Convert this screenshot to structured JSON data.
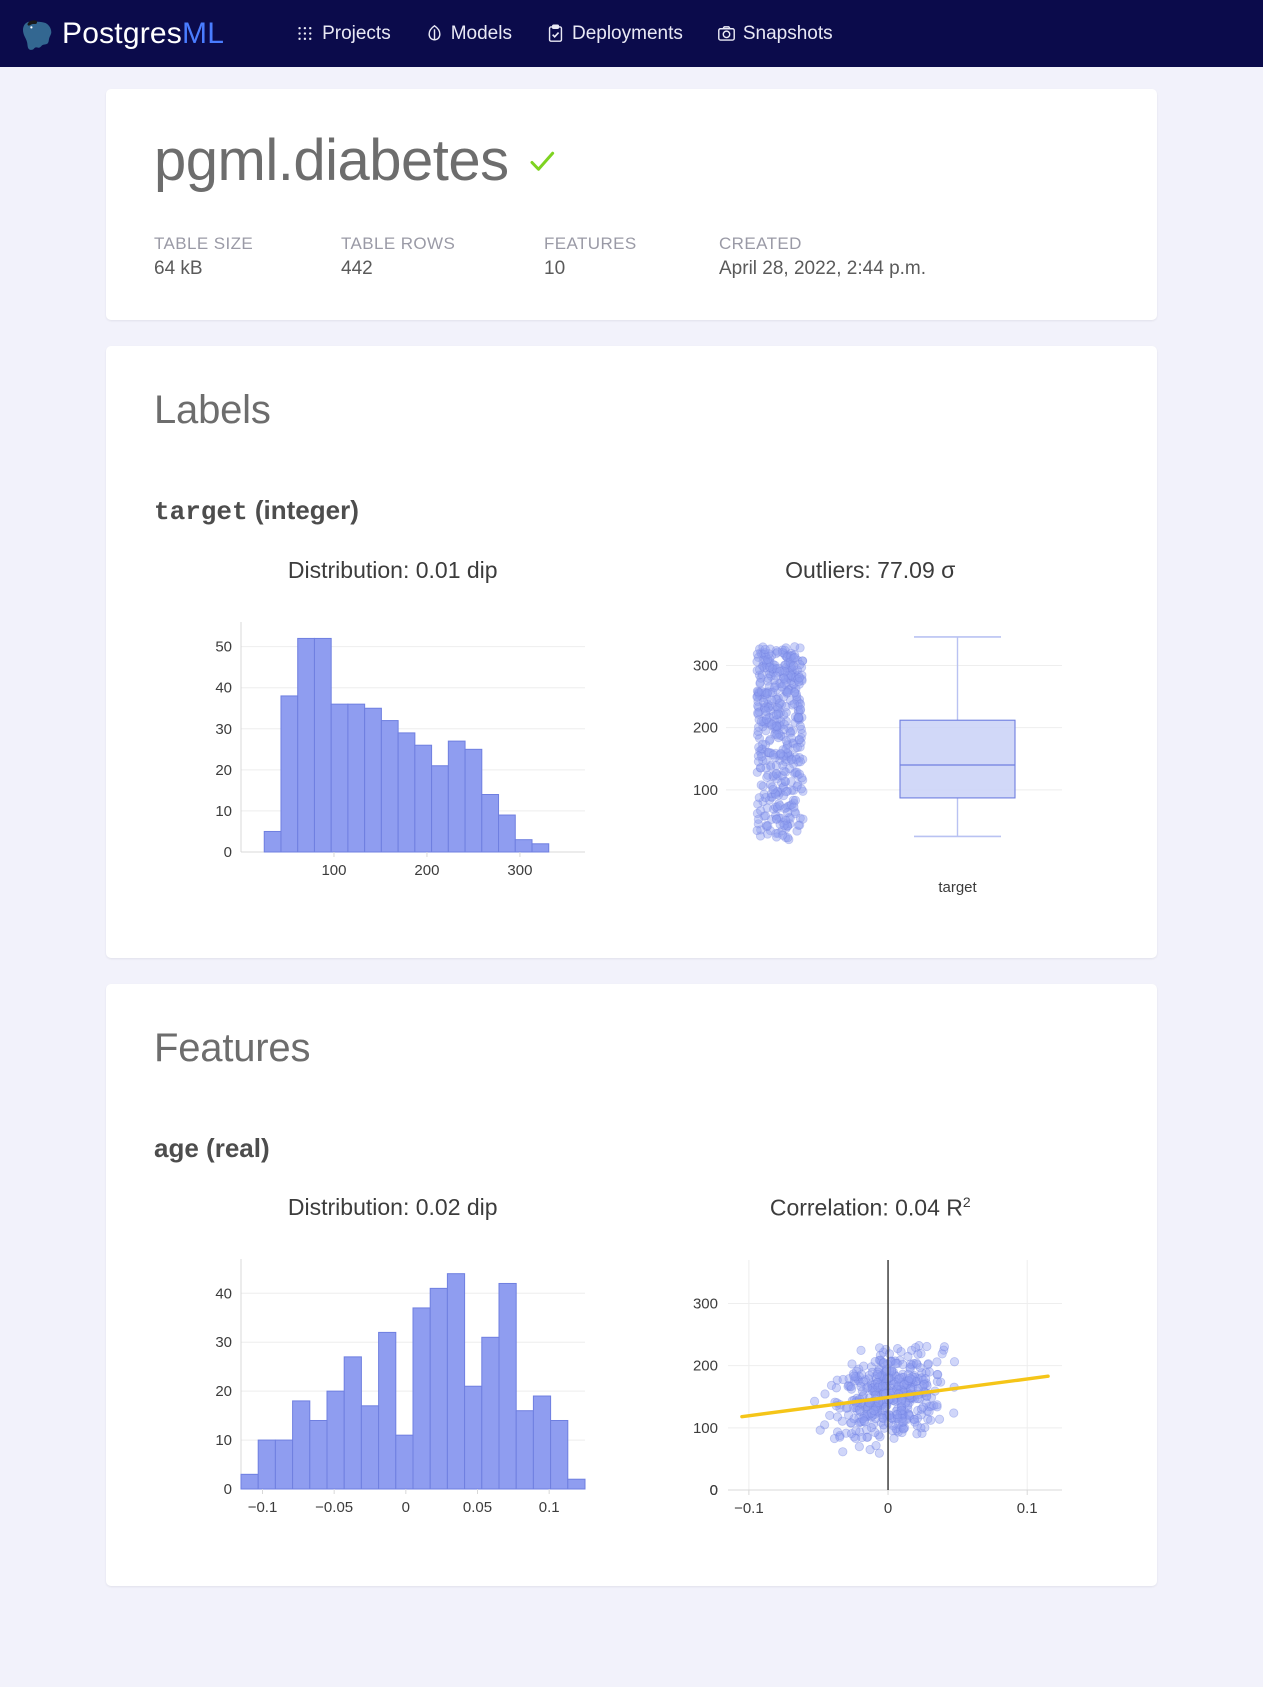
{
  "navbar": {
    "brand_primary": "Postgres",
    "brand_accent": "ML",
    "links": [
      {
        "label": "Projects",
        "icon": "grid-icon"
      },
      {
        "label": "Models",
        "icon": "model-icon"
      },
      {
        "label": "Deployments",
        "icon": "clipboard-check-icon"
      },
      {
        "label": "Snapshots",
        "icon": "camera-icon"
      }
    ]
  },
  "header": {
    "title": "pgml.diabetes",
    "status_icon": "check-icon",
    "stats": [
      {
        "label": "TABLE SIZE",
        "value": "64 kB"
      },
      {
        "label": "TABLE ROWS",
        "value": "442"
      },
      {
        "label": "FEATURES",
        "value": "10"
      },
      {
        "label": "CREATED",
        "value": "April 28, 2022, 2:44 p.m."
      }
    ]
  },
  "labels_section": {
    "heading": "Labels",
    "column_name": "target",
    "column_type": "(integer)",
    "distribution_title": "Distribution: 0.01 dip",
    "outliers_title": "Outliers: 77.09 σ"
  },
  "features_section": {
    "heading": "Features",
    "column_name": "age",
    "column_type": "(real)",
    "distribution_title": "Distribution: 0.02 dip",
    "correlation_title_prefix": "Correlation: 0.04 R",
    "correlation_title_sup": "2"
  },
  "colors": {
    "navbar_bg": "#0b0b4b",
    "brand_accent": "#4a7dff",
    "page_bg": "#f2f2fb",
    "card_bg": "#ffffff",
    "bar_fill": "#8f9df0",
    "bar_stroke": "#6f7fe0",
    "point_fill": "#8f9df0",
    "trend_line": "#f5c518",
    "check_green": "#7ed321",
    "axis_text": "#3c3c3c",
    "grid": "#eeeeee"
  },
  "chart_data": [
    {
      "type": "bar",
      "name": "target-distribution-histogram",
      "title": "Distribution: 0.01 dip",
      "xlabel": "",
      "ylabel": "",
      "xlim": [
        0,
        370
      ],
      "ylim": [
        0,
        56
      ],
      "yticks": [
        0,
        10,
        20,
        30,
        40,
        50
      ],
      "xticks": [
        100,
        200,
        300
      ],
      "bin_edges": [
        25,
        43,
        61,
        79,
        97,
        115,
        133,
        151,
        169,
        187,
        205,
        223,
        241,
        259,
        277,
        295,
        313,
        331,
        349
      ],
      "values": [
        5,
        38,
        52,
        52,
        36,
        36,
        35,
        32,
        29,
        26,
        21,
        27,
        25,
        14,
        9,
        3,
        2
      ],
      "grid": true
    },
    {
      "type": "box",
      "name": "target-outliers-boxplot",
      "title": "Outliers: 77.09 σ",
      "category_label": "target",
      "ylim": [
        0,
        370
      ],
      "yticks": [
        100,
        200,
        300
      ],
      "box": {
        "min": 25,
        "q1": 87,
        "median": 140,
        "q3": 212,
        "max": 346
      },
      "strip_points_approx": 442,
      "grid": true
    },
    {
      "type": "bar",
      "name": "age-distribution-histogram",
      "title": "Distribution: 0.02 dip",
      "xlabel": "",
      "ylabel": "",
      "xlim": [
        -0.115,
        0.125
      ],
      "ylim": [
        0,
        47
      ],
      "yticks": [
        0,
        10,
        20,
        30,
        40
      ],
      "xticks": [
        -0.1,
        -0.05,
        0,
        0.05,
        0.1
      ],
      "values": [
        3,
        10,
        10,
        18,
        14,
        20,
        27,
        17,
        32,
        11,
        37,
        41,
        44,
        21,
        31,
        42,
        16,
        19,
        14,
        2
      ],
      "grid": true
    },
    {
      "type": "scatter",
      "name": "age-target-correlation-scatter",
      "title": "Correlation: 0.04 R2",
      "xlabel": "",
      "ylabel": "",
      "xlim": [
        -0.115,
        0.125
      ],
      "ylim": [
        0,
        370
      ],
      "yticks": [
        0,
        100,
        200,
        300
      ],
      "xticks": [
        -0.1,
        0,
        0.1
      ],
      "r_squared": 0.04,
      "n_points": 442,
      "trend_line": {
        "x0": -0.105,
        "y0": 118,
        "x1": 0.115,
        "y1": 183,
        "color": "#f5c518"
      },
      "vertical_rule_at_x": 0,
      "grid": true
    }
  ]
}
